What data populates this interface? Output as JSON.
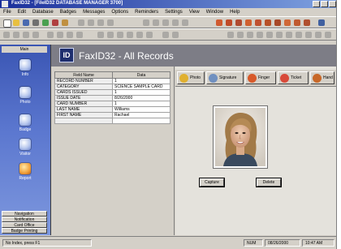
{
  "window": {
    "title": "FaxID32 - [FileID32 DATABASE MANAGER 3700]"
  },
  "menu": [
    "File",
    "Edit",
    "Database",
    "Badges",
    "Messages",
    "Options",
    "Reminders",
    "Settings",
    "View",
    "Window",
    "Help"
  ],
  "sidebar": {
    "header": "Main",
    "items": [
      {
        "label": "Info"
      },
      {
        "label": "Photo"
      },
      {
        "label": "Badge"
      },
      {
        "label": "Visitor"
      },
      {
        "label": "Report"
      }
    ],
    "bottom_buttons": [
      "Navigation",
      "Notification",
      "Card Office",
      "Badge Printing"
    ]
  },
  "banner": {
    "title": "FaxID32 - All Records"
  },
  "fields_table": {
    "headers": [
      "Field Name",
      "Data"
    ],
    "rows": [
      {
        "name": "RECORD NUMBER",
        "value": "1"
      },
      {
        "name": "CATEGORY",
        "value": "SCIENCE SAMPLE CARD"
      },
      {
        "name": "CARDS ISSUED",
        "value": "1"
      },
      {
        "name": "ISSUE DATE",
        "value": "8/26/2000"
      },
      {
        "name": "CARD NUMBER",
        "value": "1"
      },
      {
        "name": "LAST NAME",
        "value": "Williams"
      },
      {
        "name": "FIRST NAME",
        "value": "Rachael"
      },
      {
        "name": "",
        "value": ""
      }
    ]
  },
  "actions": [
    {
      "label": "Photo",
      "color": "#e0b030"
    },
    {
      "label": "Signature",
      "color": "#7090c0"
    },
    {
      "label": "Finger",
      "color": "#d85a2a"
    },
    {
      "label": "Ticket",
      "color": "#d84a3a"
    },
    {
      "label": "Hand",
      "color": "#c86828"
    }
  ],
  "photo_buttons": {
    "capture_label": "Capture",
    "clear_label": "Delete"
  },
  "statusbar": {
    "left": "No Index, press F1",
    "mode": "NUM",
    "date": "08/26/2000",
    "time": "10:47 AM"
  }
}
